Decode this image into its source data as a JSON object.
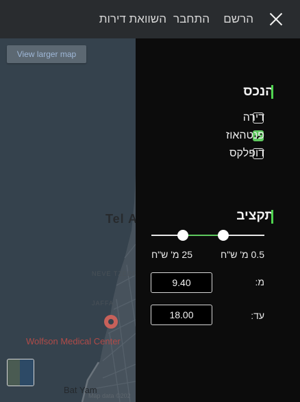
{
  "header": {
    "close_icon": "close-icon",
    "links": [
      "הרשם",
      "התחבר",
      "השוואת דירות"
    ]
  },
  "map": {
    "view_larger_label": "View larger map",
    "labels": {
      "city": "Tel A",
      "neighborhood_1": "NEVE TZEDE",
      "neighborhood_2": "JAFFA",
      "hospital": "Wolfson Medical Center",
      "town": "Bat Yam",
      "copyright": "Map data ©202"
    },
    "pin_icon": "map-pin-icon"
  },
  "filters": {
    "property_type": {
      "title": "הנכס",
      "options": [
        {
          "label": "דירה",
          "checked": false
        },
        {
          "label": "פנטהאוז",
          "checked": true
        },
        {
          "label": "דופלקס",
          "checked": false
        }
      ]
    },
    "budget": {
      "title": "תקציב",
      "slider": {
        "min_label": "0.5 מ' ש\"ח",
        "max_label": "25 מ' ש\"ח",
        "low": 9.4,
        "high": 18.0,
        "range_min": 0.5,
        "range_max": 25
      },
      "from_label": "מ:",
      "from_value": "9.40",
      "to_label": "עד:",
      "to_value": "18.00"
    }
  },
  "colors": {
    "accent": "#5fca5f",
    "panel_bg": "#0c0c0c",
    "topbar_bg": "#292c2f",
    "map_bg": "#35424d"
  }
}
